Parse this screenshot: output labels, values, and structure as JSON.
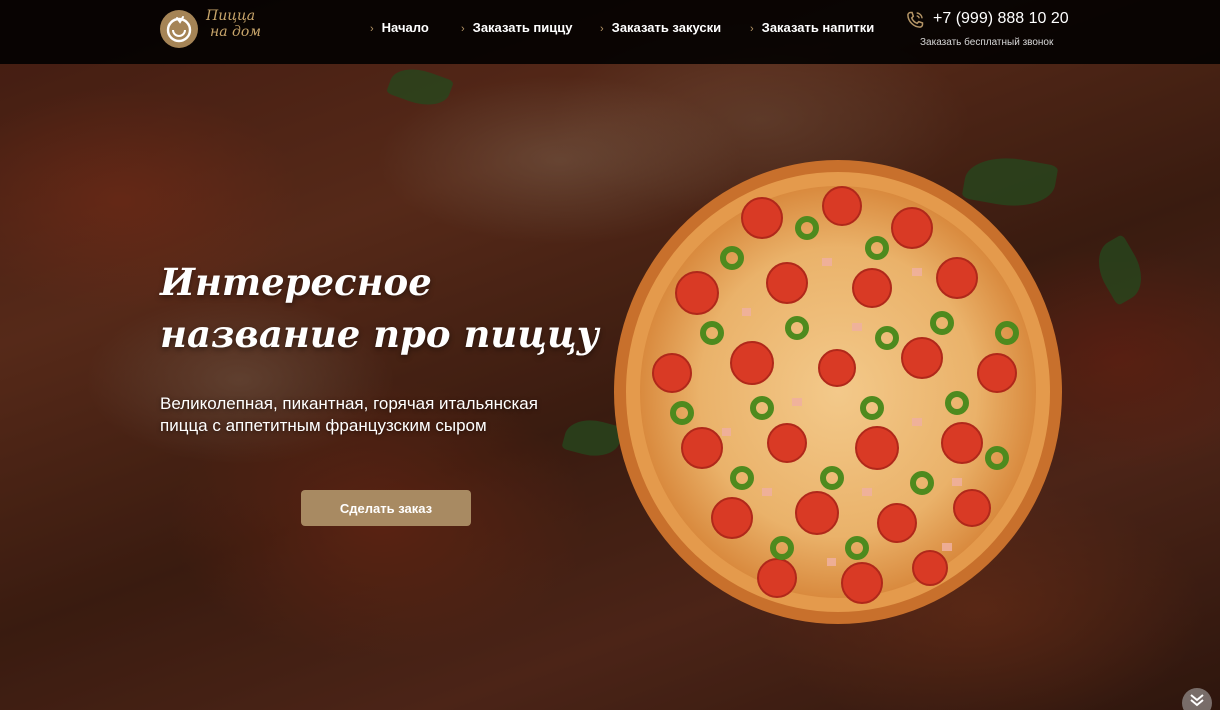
{
  "brand": {
    "line1": "Пицца",
    "line2": "на дом",
    "accent_color": "#a88a62"
  },
  "nav": {
    "items": [
      {
        "label": "Начало"
      },
      {
        "label": "Заказать пиццу"
      },
      {
        "label": "Заказать закуски"
      },
      {
        "label": "Заказать напитки"
      }
    ]
  },
  "contact": {
    "phone": "+7 (999) 888 10 20",
    "callback_label": "Заказать бесплатный звонок",
    "icon": "phone-icon"
  },
  "hero": {
    "title": "Интересное название про пиццу",
    "subtitle": "Великолепная, пикантная, горячая итальянская пицца с аппетитным французским сыром",
    "order_button_label": "Сделать заказ"
  },
  "scroll": {
    "icon": "double-chevron-down-icon"
  }
}
